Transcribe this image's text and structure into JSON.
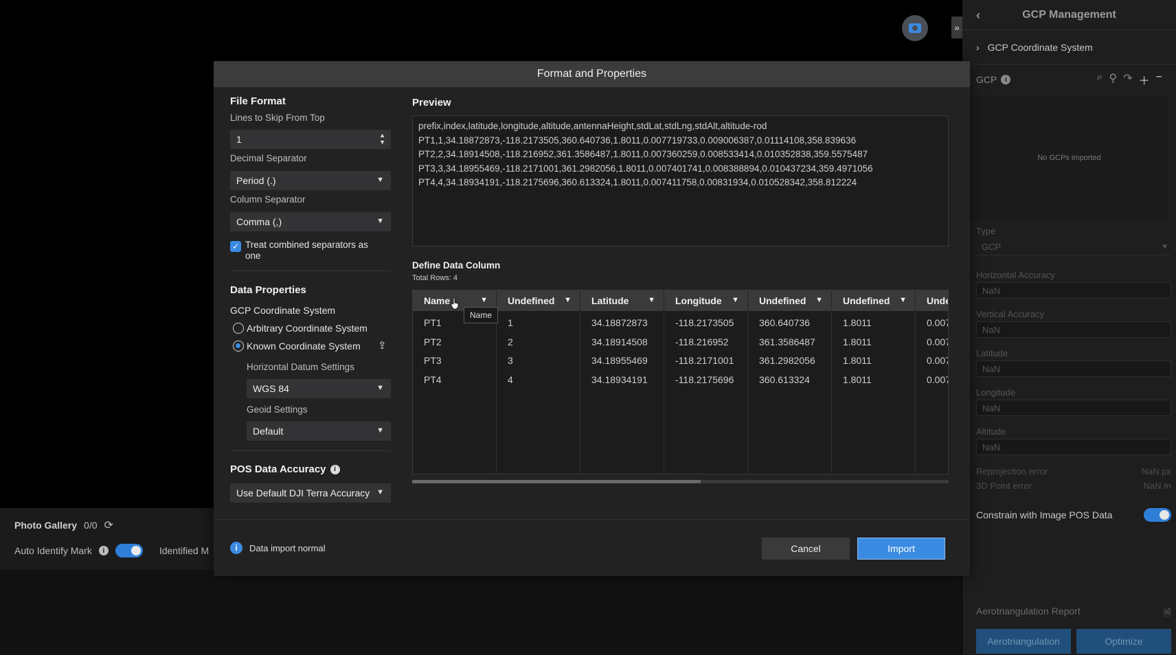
{
  "background": {
    "gallery_title": "Photo Gallery",
    "gallery_count": "0/0",
    "auto_identify_label": "Auto Identify Mark",
    "identified_label": "Identified M"
  },
  "right_panel": {
    "title": "GCP Management",
    "coord_system": "GCP Coordinate System",
    "gcp_label": "GCP",
    "empty_text": "No GCPs imported",
    "type_label": "Type",
    "type_value": "GCP",
    "horizontal_accuracy_label": "Horizontal Accuracy",
    "horizontal_accuracy_value": "NaN",
    "vertical_accuracy_label": "Vertical Accuracy",
    "vertical_accuracy_value": "NaN",
    "latitude_label": "Latitude",
    "latitude_value": "NaN",
    "longitude_label": "Longitude",
    "longitude_value": "NaN",
    "altitude_label": "Altitude",
    "altitude_value": "NaN",
    "reprojection_label": "Reprojection error",
    "reprojection_value": "NaN px",
    "point_error_label": "3D Point error",
    "point_error_value": "NaN m",
    "constrain_label": "Constrain with Image POS Data",
    "report_label": "Aerotriangulation Report",
    "aerotriangulation_button": "Aerotriangulation",
    "optimize_button": "Optimize"
  },
  "modal": {
    "title": "Format and Properties",
    "file_format_title": "File Format",
    "lines_skip_label": "Lines to Skip From Top",
    "lines_skip_value": "1",
    "decimal_sep_label": "Decimal Separator",
    "decimal_sep_value": "Period (.)",
    "column_sep_label": "Column Separator",
    "column_sep_value": "Comma (,)",
    "treat_combined_label": "Treat combined separators as one",
    "data_props_title": "Data Properties",
    "gcp_coord_label": "GCP Coordinate System",
    "arbitrary_label": "Arbitrary Coordinate System",
    "known_label": "Known Coordinate System",
    "horizontal_datum_label": "Horizontal Datum Settings",
    "horizontal_datum_value": "WGS 84",
    "geoid_label": "Geoid Settings",
    "geoid_value": "Default",
    "pos_accuracy_label": "POS Data Accuracy",
    "pos_accuracy_value": "Use Default DJI Terra Accuracy",
    "preview_title": "Preview",
    "preview_lines": [
      "prefix,index,latitude,longitude,altitude,antennaHeight,stdLat,stdLng,stdAlt,altitude-rod",
      "PT1,1,34.18872873,-118.2173505,360.640736,1.8011,0.007719733,0.009006387,0.01114108,358.839636",
      "PT2,2,34.18914508,-118.216952,361.3586487,1.8011,0.007360259,0.008533414,0.010352838,359.5575487",
      "PT3,3,34.18955469,-118.2171001,361.2982056,1.8011,0.007401741,0.008388894,0.010437234,359.4971056",
      "PT4,4,34.18934191,-118.2175696,360.613324,1.8011,0.007411758,0.00831934,0.010528342,358.812224"
    ],
    "define_title": "Define Data Column",
    "total_rows": "Total Rows: 4",
    "columns": [
      {
        "header": "Name",
        "cells": [
          "PT1",
          "PT2",
          "PT3",
          "PT4"
        ]
      },
      {
        "header": "Undefined",
        "cells": [
          "1",
          "2",
          "3",
          "4"
        ]
      },
      {
        "header": "Latitude",
        "cells": [
          "34.18872873",
          "34.18914508",
          "34.18955469",
          "34.18934191"
        ]
      },
      {
        "header": "Longitude",
        "cells": [
          "-118.2173505",
          "-118.216952",
          "-118.2171001",
          "-118.2175696"
        ]
      },
      {
        "header": "Undefined",
        "cells": [
          "360.640736",
          "361.3586487",
          "361.2982056",
          "360.613324"
        ]
      },
      {
        "header": "Undefined",
        "cells": [
          "1.8011",
          "1.8011",
          "1.8011",
          "1.8011"
        ]
      },
      {
        "header": "Unde",
        "cells": [
          "0.007",
          "0.007",
          "0.007",
          "0.007"
        ]
      }
    ],
    "tooltip": "Name",
    "status_text": "Data import normal",
    "cancel_button": "Cancel",
    "import_button": "Import"
  }
}
